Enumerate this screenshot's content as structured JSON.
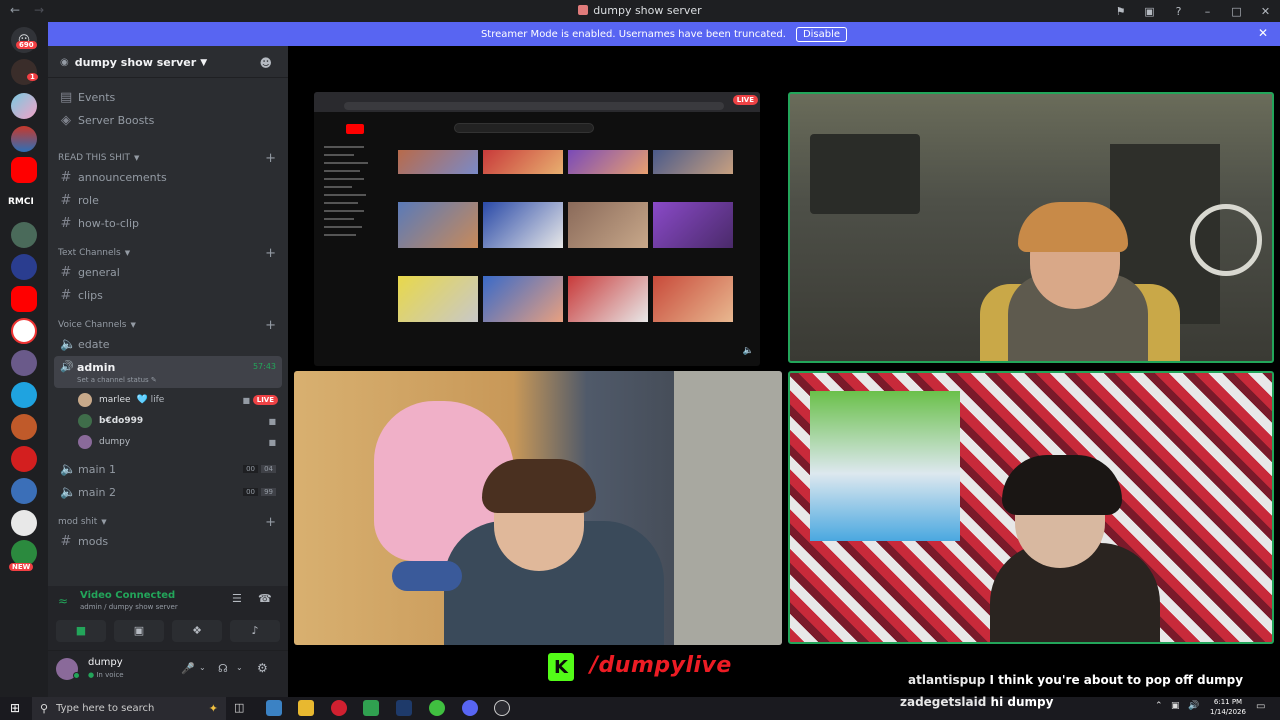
{
  "window": {
    "title": "dumpy show server"
  },
  "banner": {
    "text": "Streamer Mode is enabled. Usernames have been truncated.",
    "button": "Disable"
  },
  "rail": {
    "badge_top": "690",
    "badge_second": "1",
    "label_rmci": "RMCI",
    "new_badge": "NEW"
  },
  "server": {
    "name": "dumpy show server"
  },
  "top_items": [
    {
      "label": "Events",
      "icon": "calendar-icon"
    },
    {
      "label": "Server Boosts",
      "icon": "boost-icon"
    }
  ],
  "categories": {
    "read": "READ THIS SHIT",
    "text": "Text Channels",
    "voice": "Voice Channels",
    "mod": "mod shit"
  },
  "read_channels": [
    "announcements",
    "role",
    "how-to-clip"
  ],
  "text_channels": [
    "general",
    "clips"
  ],
  "voice": {
    "edate": "edate",
    "admin": {
      "name": "admin",
      "timer": "57:43",
      "status": "Set a channel status"
    },
    "users": [
      {
        "name": "marlee",
        "extra": "🩵 life",
        "live": "LIVE"
      },
      {
        "name": "b€do999",
        "extra": "",
        "live": ""
      },
      {
        "name": "dumpy",
        "extra": "",
        "live": ""
      }
    ],
    "main1": {
      "name": "main 1",
      "a": "00",
      "b": "04"
    },
    "main2": {
      "name": "main 2",
      "a": "00",
      "b": "99"
    }
  },
  "mod_channels": [
    "mods"
  ],
  "rtc": {
    "status": "Video Connected",
    "location": "admin / dumpy show server"
  },
  "user": {
    "name": "dumpy",
    "status": "In voice"
  },
  "stream": {
    "live_label": "LIVE"
  },
  "overlay": {
    "handle": "/dumpylive",
    "k": "K",
    "chat": [
      {
        "user": "atlantispup",
        "msg": "I think you're about to pop off dumpy"
      },
      {
        "user": "zadegetslaid",
        "msg": "hi dumpy"
      }
    ]
  },
  "taskbar": {
    "search_placeholder": "Type here to search",
    "time": "6:11 PM",
    "date": "1/14/2026"
  },
  "colors": {
    "accent": "#5865f2",
    "live": "#ed4245",
    "green": "#23a55a",
    "kick": "#53fc18"
  }
}
